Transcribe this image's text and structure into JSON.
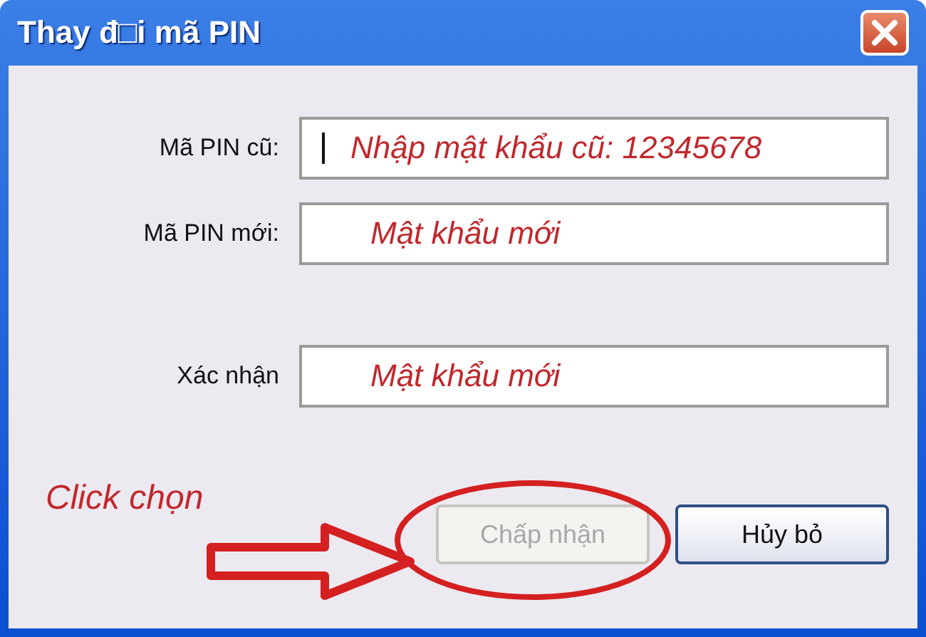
{
  "window": {
    "title": "Thay đ□i mã PIN"
  },
  "fields": [
    {
      "label": "Mã PIN cũ:",
      "value": "Nhập mật khẩu cũ: 12345678",
      "focused": true
    },
    {
      "label": "Mã PIN mới:",
      "value": "Mật khẩu mới",
      "focused": false
    },
    {
      "label": "Xác nhận",
      "value": "Mật khẩu mới",
      "focused": false
    }
  ],
  "buttons": [
    {
      "label": "Chấp nhận",
      "disabled": true,
      "highlighted": true
    },
    {
      "label": "Hủy bỏ",
      "disabled": false,
      "highlighted": false
    }
  ],
  "annotation": {
    "text": "Click chọn"
  }
}
